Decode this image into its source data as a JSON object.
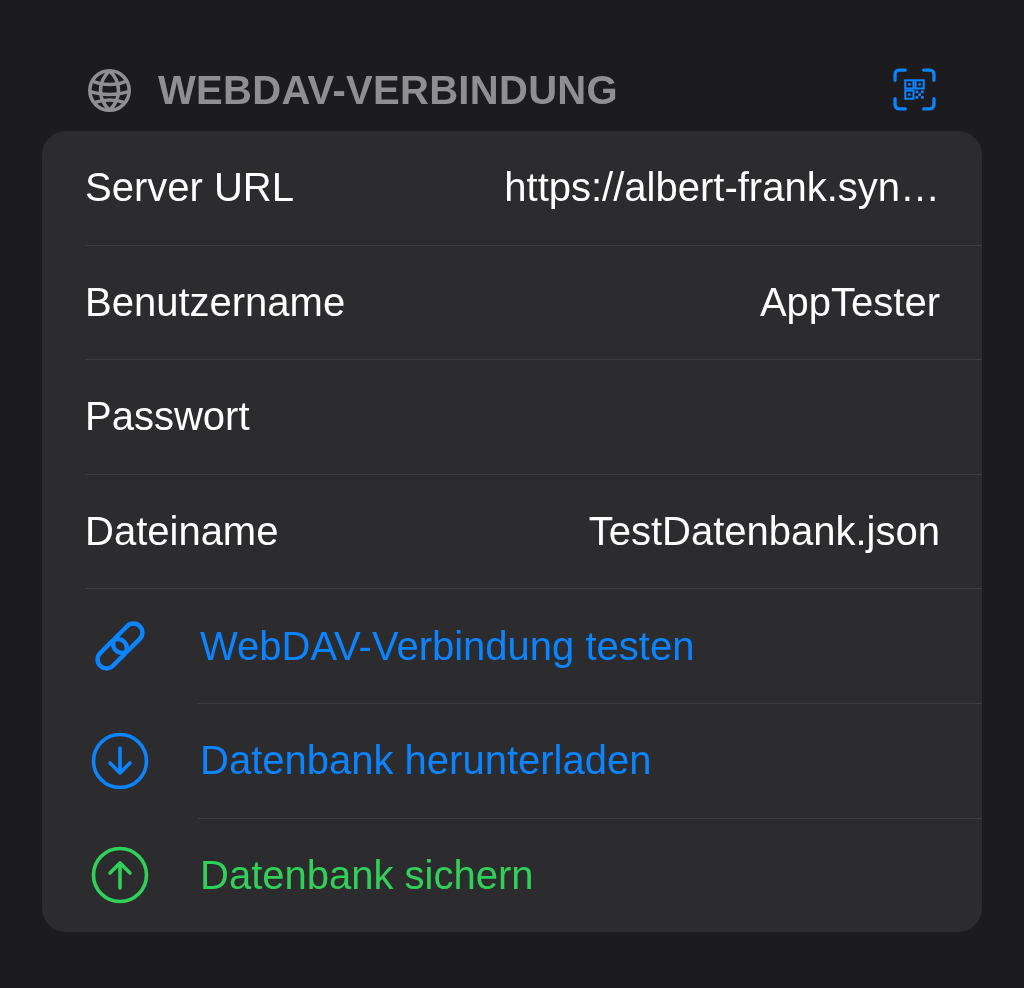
{
  "section": {
    "title": "WEBDAV-VERBINDUNG"
  },
  "fields": [
    {
      "label": "Server URL",
      "value": "https://albert-frank.syn…"
    },
    {
      "label": "Benutzername",
      "value": "AppTester"
    },
    {
      "label": "Passwort"
    },
    {
      "label": "Dateiname",
      "value": "TestDatenbank.json"
    }
  ],
  "actions": [
    {
      "kind": "link",
      "label": "WebDAV-Verbindung testen",
      "color": "#0a84ff"
    },
    {
      "kind": "download",
      "label": "Datenbank herunterladen",
      "color": "#0a84ff"
    },
    {
      "kind": "upload",
      "label": "Datenbank sichern",
      "color": "#30d158"
    }
  ]
}
